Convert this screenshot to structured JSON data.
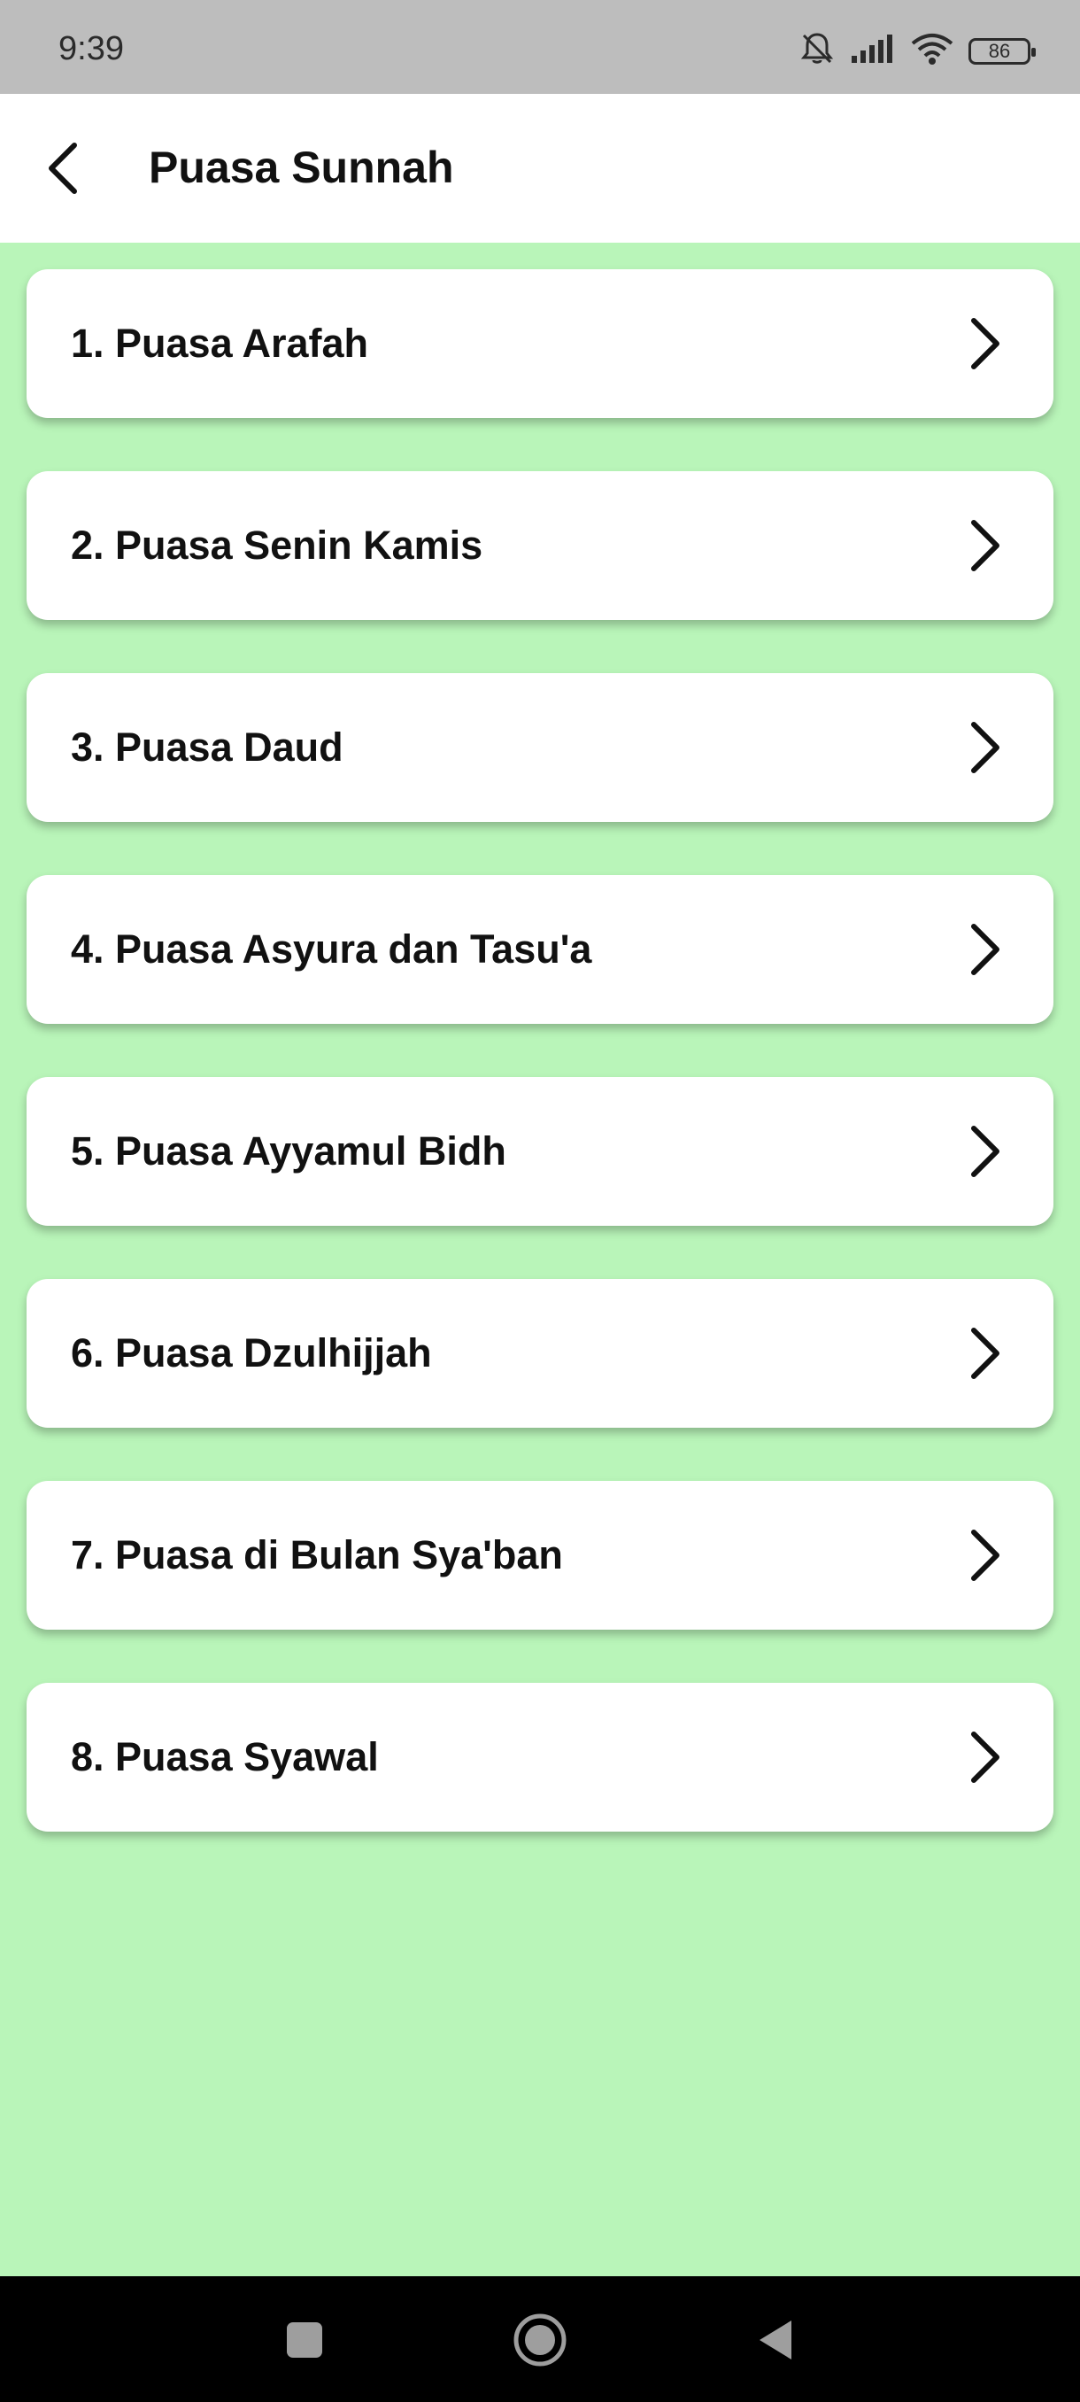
{
  "status_bar": {
    "time": "9:39",
    "battery": "86",
    "icons": [
      "bell-muted-icon",
      "signal-icon",
      "wifi-icon",
      "battery-icon"
    ]
  },
  "header": {
    "title": "Puasa Sunnah",
    "back_icon": "back-arrow-icon"
  },
  "list": {
    "items": [
      {
        "label": "1. Puasa Arafah"
      },
      {
        "label": "2. Puasa Senin Kamis"
      },
      {
        "label": "3. Puasa Daud"
      },
      {
        "label": "4. Puasa Asyura dan Tasu'a"
      },
      {
        "label": "5. Puasa Ayyamul Bidh"
      },
      {
        "label": "6. Puasa Dzulhijjah"
      },
      {
        "label": "7. Puasa di Bulan Sya'ban"
      },
      {
        "label": "8. Puasa Syawal"
      }
    ]
  },
  "navigation": {
    "buttons": [
      "recents-icon",
      "home-icon",
      "back-triangle-icon"
    ]
  },
  "colors": {
    "background": "#b9f5b9",
    "app_bar": "#ffffff",
    "status_bar": "#bdbdbd",
    "nav_bar": "#000000"
  }
}
